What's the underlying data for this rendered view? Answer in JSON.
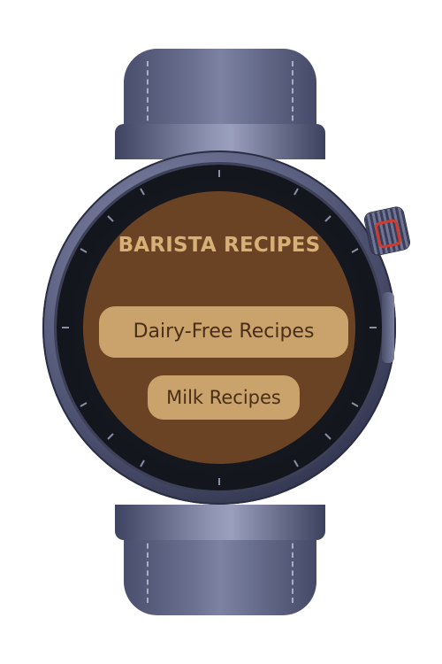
{
  "app": {
    "title": "BARISTA RECIPES"
  },
  "menu": {
    "items": [
      {
        "label": "Dairy-Free Recipes"
      },
      {
        "label": "Milk Recipes"
      }
    ]
  },
  "colors": {
    "screen_background": "#6a4325",
    "title_text": "#d7b077",
    "button_background": "#c9a36b",
    "button_text": "#4a2e17",
    "watch_body": "#5e6384",
    "crown_accent": "#d0392b"
  }
}
